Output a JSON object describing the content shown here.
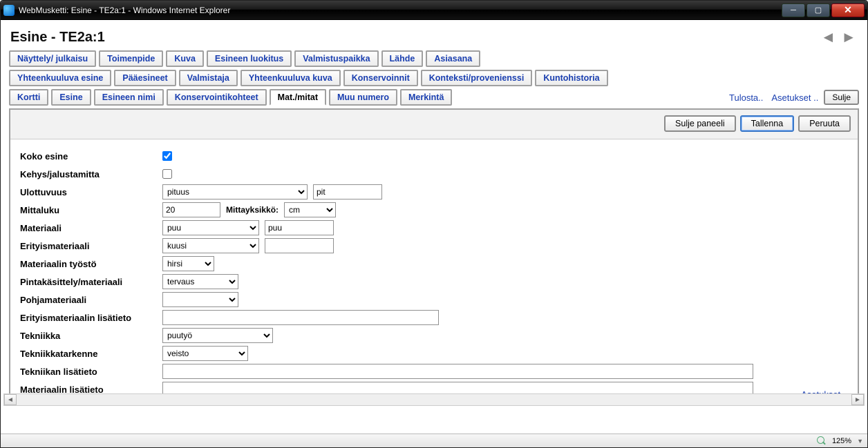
{
  "window": {
    "title": "WebMusketti: Esine - TE2a:1 - Windows Internet Explorer"
  },
  "header": {
    "title": "Esine  - TE2a:1"
  },
  "tabrows": {
    "row1": [
      "Näyttely/ julkaisu",
      "Toimenpide",
      "Kuva",
      "Esineen luokitus",
      "Valmistuspaikka",
      "Lähde",
      "Asiasana"
    ],
    "row2": [
      "Yhteenkuuluva esine",
      "Pääesineet",
      "Valmistaja",
      "Yhteenkuuluva kuva",
      "Konservoinnit",
      "Konteksti/provenienssi",
      "Kuntohistoria"
    ],
    "row3": [
      "Kortti",
      "Esine",
      "Esineen nimi",
      "Konservointikohteet",
      "Mat./mitat",
      "Muu numero",
      "Merkintä"
    ],
    "active_row": 3,
    "active_index": 4,
    "links": {
      "print": "Tulosta..",
      "settings": "Asetukset .."
    },
    "close_btn": "Sulje"
  },
  "panel": {
    "buttons": {
      "close_panel": "Sulje paneeli",
      "save": "Tallenna",
      "cancel": "Peruuta"
    }
  },
  "form": {
    "koko_esine": {
      "label": "Koko esine",
      "checked": true
    },
    "kehys": {
      "label": "Kehys/jalustamitta",
      "checked": false
    },
    "ulottuvuus": {
      "label": "Ulottuvuus",
      "select": "pituus",
      "text": "pit"
    },
    "mittaluku": {
      "label": "Mittaluku",
      "value": "20",
      "unit_label": "Mittayksikkö:",
      "unit": "cm"
    },
    "materiaali": {
      "label": "Materiaali",
      "select": "puu",
      "text": "puu"
    },
    "erityismateriaali": {
      "label": "Erityismateriaali",
      "select": "kuusi",
      "text": ""
    },
    "tyosto": {
      "label": "Materiaalin työstö",
      "select": "hirsi"
    },
    "pintakasittely": {
      "label": "Pintakäsittely/materiaali",
      "select": "tervaus"
    },
    "pohjamateriaali": {
      "label": "Pohjamateriaali",
      "select": ""
    },
    "erityis_lisa": {
      "label": "Erityismateriaalin lisätieto",
      "text": ""
    },
    "tekniikka": {
      "label": "Tekniikka",
      "select": "puutyö"
    },
    "tekniikkatarkenne": {
      "label": "Tekniikkatarkenne",
      "select": "veisto"
    },
    "tekniikan_lisatieto": {
      "label": "Tekniikan lisätieto",
      "text": ""
    },
    "materiaalin_lisatieto": {
      "label": "Materiaalin lisätieto",
      "text": ""
    }
  },
  "footer": {
    "settings_link": "Asetukset .."
  },
  "status": {
    "zoom": "125%"
  }
}
